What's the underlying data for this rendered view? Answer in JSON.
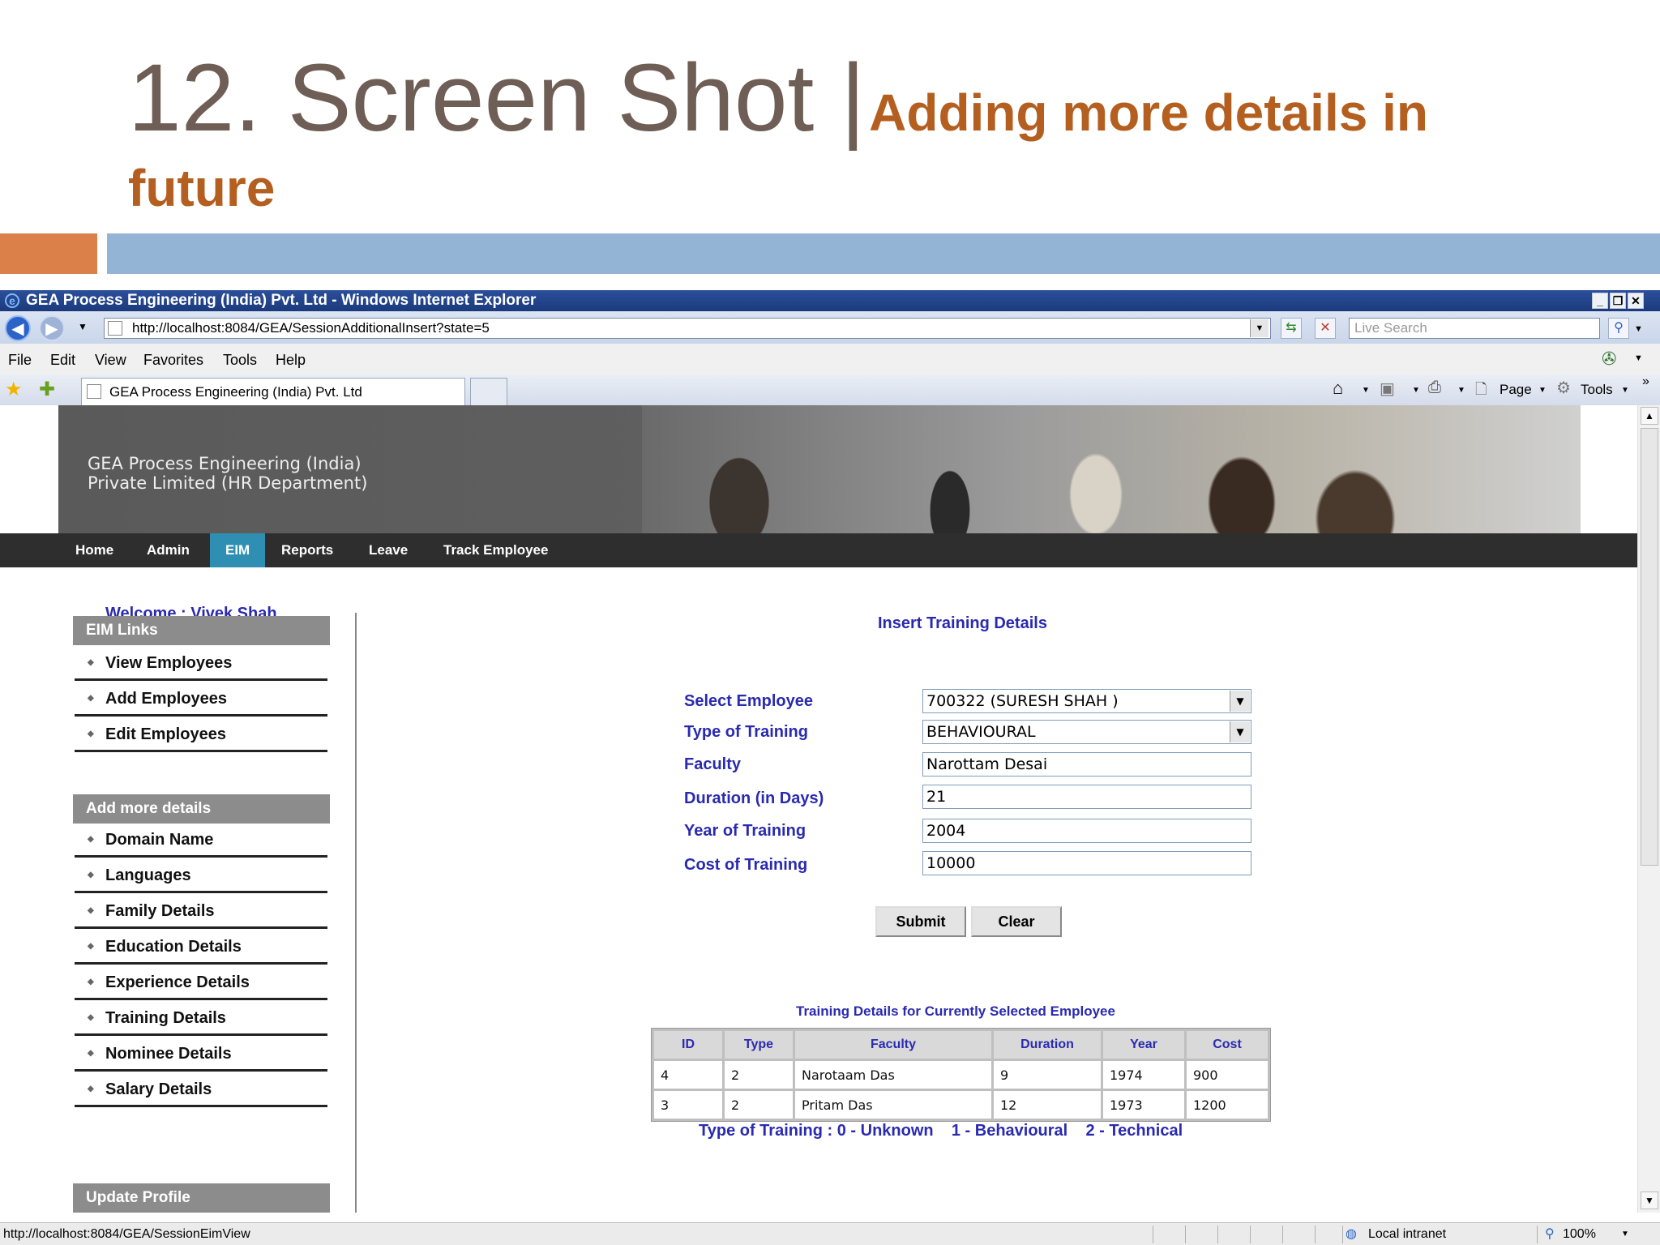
{
  "slide": {
    "title_main": "12. Screen Shot |",
    "title_sub": "Adding more details in",
    "title_line2": "future"
  },
  "window": {
    "title": "GEA Process Engineering (India) Pvt. Ltd - Windows Internet Explorer",
    "url": "http://localhost:8084/GEA/SessionAdditionalInsert?state=5",
    "search_placeholder": "Live Search",
    "menu": [
      "File",
      "Edit",
      "View",
      "Favorites",
      "Tools",
      "Help"
    ],
    "tab_label": "GEA Process Engineering (India) Pvt. Ltd",
    "cmd_page": "Page",
    "cmd_tools": "Tools",
    "status_url": "http://localhost:8084/GEA/SessionEimView",
    "zone": "Local intranet",
    "zoom": "100%"
  },
  "site": {
    "brand_line1": "GEA Process Engineering (India)",
    "brand_line2": "Private Limited (HR Department)",
    "nav": [
      "Home",
      "Admin",
      "EIM",
      "Reports",
      "Leave",
      "Track Employee"
    ],
    "active_nav": "EIM",
    "welcome": "Welcome :  Vivek Shah"
  },
  "sidebar": {
    "eim_header": "EIM Links",
    "eim_links": [
      "View Employees",
      "Add Employees",
      "Edit Employees"
    ],
    "more_header": "Add more details",
    "more_links": [
      "Domain Name",
      "Languages",
      "Family Details",
      "Education Details",
      "Experience Details",
      "Training Details",
      "Nominee Details",
      "Salary Details"
    ],
    "update_header": "Update Profile"
  },
  "form": {
    "title": "Insert Training Details",
    "fields": [
      {
        "label": "Select Employee",
        "value": "700322 (SURESH   SHAH )"
      },
      {
        "label": "Type of Training",
        "value": "BEHAVIOURAL"
      },
      {
        "label": "Faculty",
        "value": "Narottam Desai"
      },
      {
        "label": "Duration (in Days)",
        "value": "21"
      },
      {
        "label": "Year of Training",
        "value": "2004"
      },
      {
        "label": "Cost of Training",
        "value": "10000"
      }
    ],
    "submit_label": "Submit",
    "clear_label": "Clear"
  },
  "training_table": {
    "caption": "Training Details for Currently Selected Employee",
    "headers": [
      "ID",
      "Type",
      "Faculty",
      "Duration",
      "Year",
      "Cost"
    ],
    "rows": [
      [
        "4",
        "2",
        "Narotaam Das",
        "9",
        "1974",
        "900"
      ],
      [
        "3",
        "2",
        "Pritam Das",
        "12",
        "1973",
        "1200"
      ]
    ]
  },
  "legend": "Type of Training : 0 - Unknown    1 - Behavioural    2 - Technical",
  "colors": {
    "title_gray": "#6e5e55",
    "title_orange": "#b45f1f",
    "accent_orange": "#dc804a",
    "accent_blue": "#94b4d6",
    "link_blue": "#2a2ab0",
    "nav_active": "#2f8fb3"
  }
}
